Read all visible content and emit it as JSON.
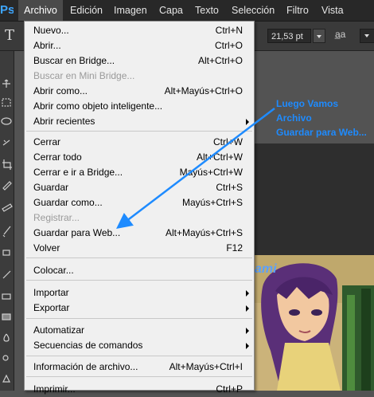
{
  "menubar": {
    "logo": "Ps",
    "items": [
      "Archivo",
      "Edición",
      "Imagen",
      "Capa",
      "Texto",
      "Selección",
      "Filtro",
      "Vista"
    ]
  },
  "options": {
    "tool_glyph": "T",
    "font_size": "21,53 pt",
    "antialias_icon": "a̲a"
  },
  "menu": {
    "items": [
      {
        "label": "Nuevo...",
        "shortcut": "Ctrl+N"
      },
      {
        "label": "Abrir...",
        "shortcut": "Ctrl+O"
      },
      {
        "label": "Buscar en Bridge...",
        "shortcut": "Alt+Ctrl+O"
      },
      {
        "label": "Buscar en Mini Bridge...",
        "shortcut": "",
        "disabled": true
      },
      {
        "label": "Abrir como...",
        "shortcut": "Alt+Mayús+Ctrl+O"
      },
      {
        "label": "Abrir como objeto inteligente...",
        "shortcut": ""
      },
      {
        "label": "Abrir recientes",
        "shortcut": "",
        "submenu": true
      },
      {
        "label": "Cerrar",
        "shortcut": "Ctrl+W"
      },
      {
        "label": "Cerrar todo",
        "shortcut": "Alt+Ctrl+W"
      },
      {
        "label": "Cerrar e ir a Bridge...",
        "shortcut": "Mayús+Ctrl+W"
      },
      {
        "label": "Guardar",
        "shortcut": "Ctrl+S"
      },
      {
        "label": "Guardar como...",
        "shortcut": "Mayús+Ctrl+S"
      },
      {
        "label": "Registrar...",
        "shortcut": "",
        "disabled": true
      },
      {
        "label": "Guardar para Web...",
        "shortcut": "Alt+Mayús+Ctrl+S"
      },
      {
        "label": "Volver",
        "shortcut": "F12"
      },
      {
        "label": "Colocar...",
        "shortcut": ""
      },
      {
        "label": "Importar",
        "shortcut": "",
        "submenu": true
      },
      {
        "label": "Exportar",
        "shortcut": "",
        "submenu": true
      },
      {
        "label": "Automatizar",
        "shortcut": "",
        "submenu": true
      },
      {
        "label": "Secuencias de comandos",
        "shortcut": "",
        "submenu": true
      },
      {
        "label": "Información de archivo...",
        "shortcut": "Alt+Mayús+Ctrl+I"
      },
      {
        "label": "Imprimir...",
        "shortcut": "Ctrl+P"
      }
    ]
  },
  "annotation": {
    "lines": [
      "Luego Vamos",
      "Archivo",
      "Guardar para Web..."
    ],
    "color": "#1e8bff"
  },
  "canvas": {
    "watermark": "ami"
  }
}
